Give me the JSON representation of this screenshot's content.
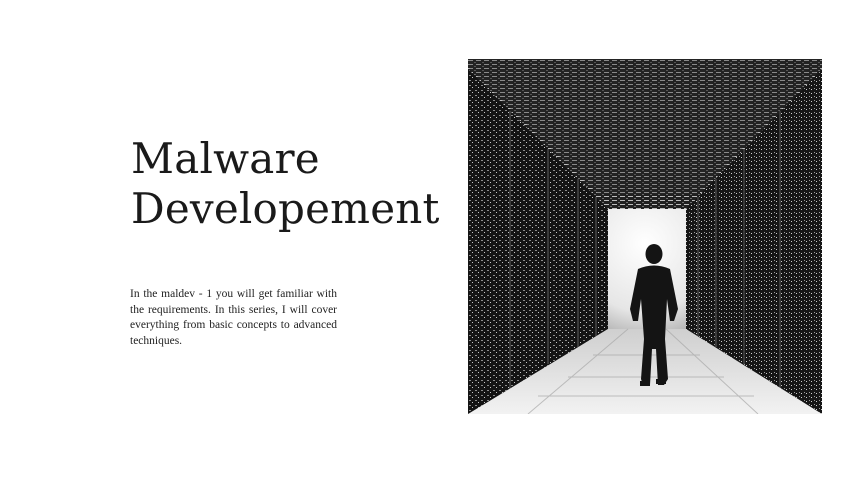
{
  "slide": {
    "title_line_1": "Malware",
    "title_line_2": "Developement",
    "body": "In the maldev - 1 you will get familiar with the requirements. In this series, I will cover everything from basic concepts to advanced techniques."
  },
  "image": {
    "subject": "server-corridor-silhouette",
    "palette": {
      "dark": "#1b1b1b",
      "light": "#f4f4f4",
      "mid": "#7a7a7a"
    }
  }
}
